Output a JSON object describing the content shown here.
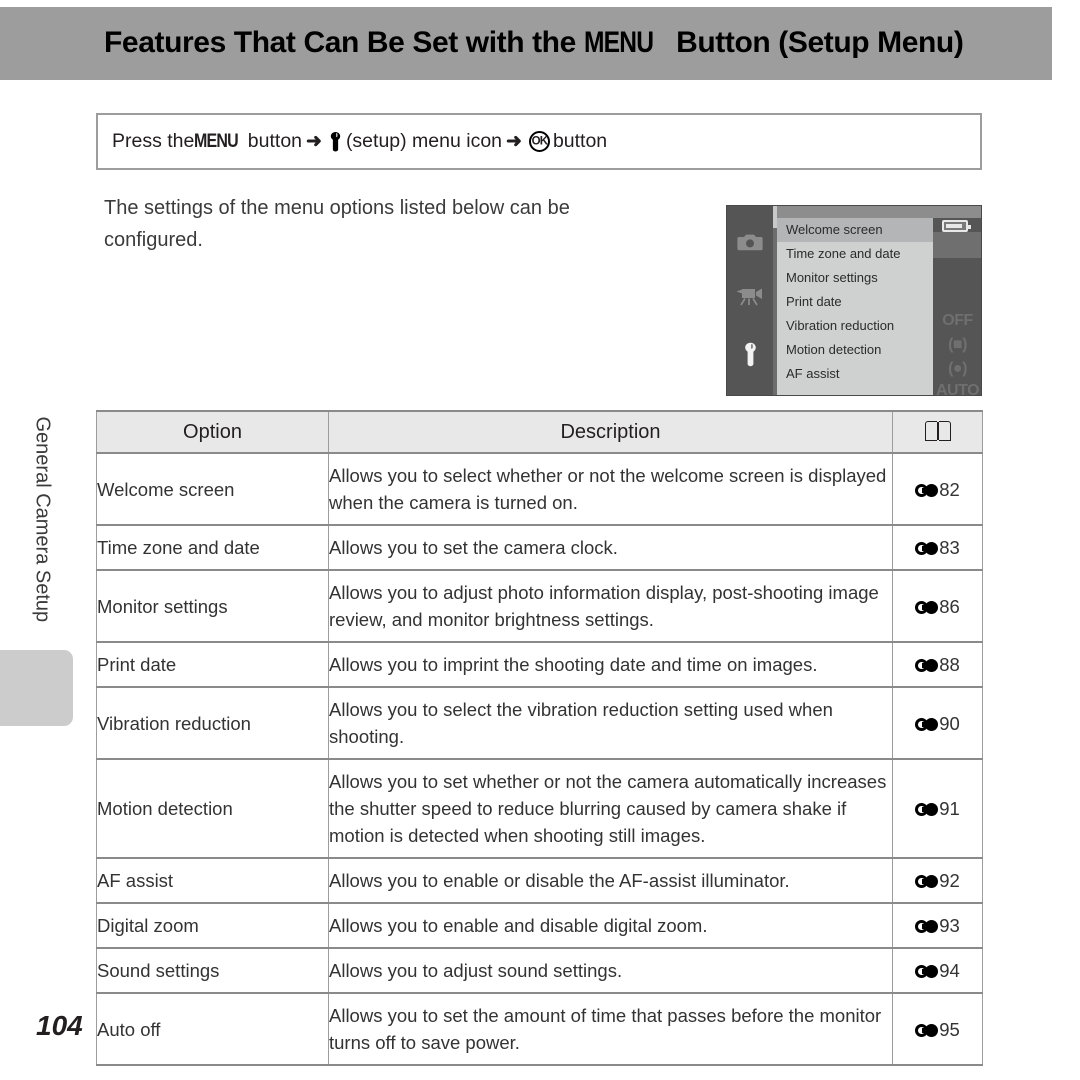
{
  "header": {
    "title_before": "Features That Can Be Set with the ",
    "title_menu": "MENU",
    "title_after": " Button (Setup Menu)",
    "banner_color": "#9d9d9d"
  },
  "instruction": {
    "seg1": "Press the ",
    "menu_label": "MENU",
    "seg2": " button",
    "arrow1": "➜",
    "wrench_icon": "wrench-icon",
    "seg3": " (setup) menu icon",
    "arrow2": "➜",
    "ok_label": "OK",
    "seg4": " button"
  },
  "body": {
    "paragraph": "The settings of the menu options listed below can be configured."
  },
  "camera_screen": {
    "sidebar_icons": [
      {
        "name": "shooting-camera-icon",
        "glyph": "■",
        "active": false
      },
      {
        "name": "movie-camera-icon",
        "glyph": "■",
        "active": false
      },
      {
        "name": "setup-wrench-icon",
        "glyph": "■",
        "active": true
      }
    ],
    "menu_items": [
      {
        "label": "Welcome screen",
        "selected": true
      },
      {
        "label": "Time zone and date",
        "selected": false
      },
      {
        "label": "Monitor settings",
        "selected": false
      },
      {
        "label": "Print date",
        "selected": false
      },
      {
        "label": "Vibration reduction",
        "selected": false
      },
      {
        "label": "Motion detection",
        "selected": false
      },
      {
        "label": "AF assist",
        "selected": false
      }
    ],
    "right_icons": {
      "battery": "battery-icon",
      "off": "OFF",
      "vr": "(■)",
      "motion": "(●)",
      "auto": "AUTO"
    }
  },
  "side_tab": {
    "label": "General Camera Setup"
  },
  "table": {
    "headers": {
      "option": "Option",
      "description": "Description",
      "reference": "book-icon"
    },
    "rows": [
      {
        "option": "Welcome screen",
        "description": "Allows you to select whether or not the welcome screen is displayed when the camera is turned on.",
        "ref_page": "82"
      },
      {
        "option": "Time zone and date",
        "description": "Allows you to set the camera clock.",
        "ref_page": "83"
      },
      {
        "option": "Monitor settings",
        "description": "Allows you to adjust photo information display, post-shooting image review, and monitor brightness settings.",
        "ref_page": "86"
      },
      {
        "option": "Print date",
        "description": "Allows you to imprint the shooting date and time on images.",
        "ref_page": "88"
      },
      {
        "option": "Vibration reduction",
        "description": "Allows you to select the vibration reduction setting used when shooting.",
        "ref_page": "90"
      },
      {
        "option": "Motion detection",
        "description": "Allows you to set whether or not the camera automatically increases the shutter speed to reduce blurring caused by camera shake if motion is detected when shooting still images.",
        "ref_page": "91"
      },
      {
        "option": "AF assist",
        "description": "Allows you to enable or disable the AF-assist illuminator.",
        "ref_page": "92"
      },
      {
        "option": "Digital zoom",
        "description": "Allows you to enable and disable digital zoom.",
        "ref_page": "93"
      },
      {
        "option": "Sound settings",
        "description": "Allows you to adjust sound settings.",
        "ref_page": "94"
      },
      {
        "option": "Auto off",
        "description": "Allows you to set the amount of time that passes before the monitor turns off to save power.",
        "ref_page": "95"
      }
    ]
  },
  "footer": {
    "page_number": "104"
  }
}
